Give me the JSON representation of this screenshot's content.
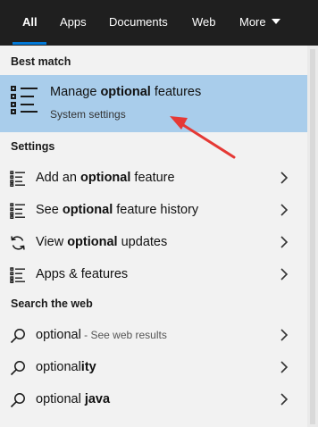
{
  "tabs": [
    {
      "label": "All",
      "active": true
    },
    {
      "label": "Apps"
    },
    {
      "label": "Documents"
    },
    {
      "label": "Web"
    },
    {
      "label": "More"
    }
  ],
  "best_match": {
    "heading": "Best match",
    "title_pre": "Manage ",
    "title_bold": "optional",
    "title_post": " features",
    "subtitle": "System settings",
    "icon": "settings-list-icon"
  },
  "settings": {
    "heading": "Settings",
    "items": [
      {
        "pre": "Add an ",
        "bold": "optional",
        "post": " feature",
        "icon": "settings-list-icon"
      },
      {
        "pre": "See ",
        "bold": "optional",
        "post": " feature history",
        "icon": "settings-list-icon"
      },
      {
        "pre": "View ",
        "bold": "optional",
        "post": " updates",
        "icon": "refresh-icon"
      },
      {
        "pre": "Apps & features",
        "bold": "",
        "post": "",
        "icon": "settings-list-icon"
      }
    ]
  },
  "web": {
    "heading": "Search the web",
    "items": [
      {
        "pre": "optional",
        "bold": "",
        "muted": " - See web results",
        "icon": "search-icon"
      },
      {
        "pre": "optional",
        "bold": "ity",
        "muted": "",
        "icon": "search-icon"
      },
      {
        "pre": "optional ",
        "bold": "java",
        "muted": "",
        "icon": "search-icon"
      }
    ]
  },
  "colors": {
    "topbar": "#1f1f1f",
    "accent": "#0078d7",
    "highlight": "#a9cdeb",
    "annotation_arrow": "#e53935"
  }
}
